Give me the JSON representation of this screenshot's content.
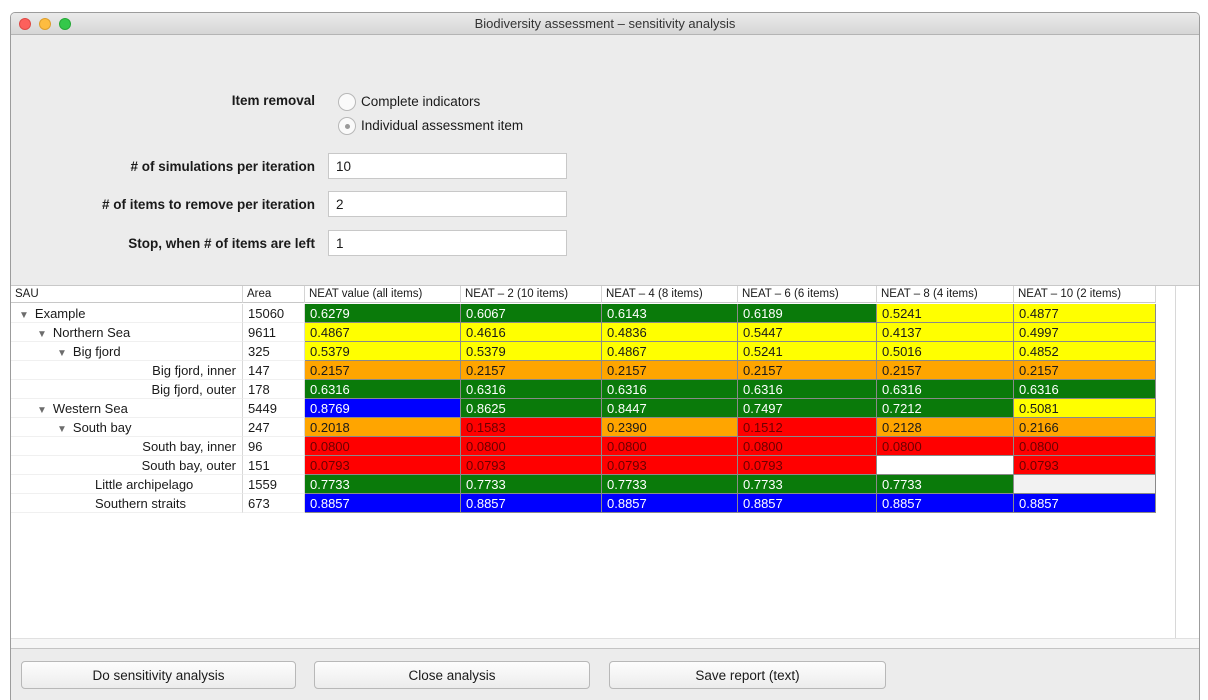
{
  "window": {
    "title": "Biodiversity assessment – sensitivity analysis"
  },
  "form": {
    "item_removal_label": "Item removal",
    "radio_options": [
      {
        "label": "Complete indicators",
        "selected": false
      },
      {
        "label": "Individual assessment item",
        "selected": true
      }
    ],
    "simulations_label": "# of simulations per iteration",
    "simulations_value": "10",
    "remove_label": "# of items to remove per iteration",
    "remove_value": "2",
    "stop_label": "Stop, when # of items are left",
    "stop_value": "1"
  },
  "table": {
    "headers": [
      "SAU",
      "Area",
      "NEAT value (all items)",
      "NEAT – 2 (10 items)",
      "NEAT – 4 (8 items)",
      "NEAT – 6 (6 items)",
      "NEAT – 8 (4 items)",
      "NEAT – 10 (2 items)"
    ],
    "rows": [
      {
        "sau": "Example",
        "area": "15060",
        "values": [
          "0.6279",
          "0.6067",
          "0.6143",
          "0.6189",
          "0.5241",
          "0.4877"
        ],
        "colors": [
          "green",
          "green",
          "green",
          "green",
          "yellow",
          "yellow"
        ]
      },
      {
        "sau": "Northern Sea",
        "area": "9611",
        "values": [
          "0.4867",
          "0.4616",
          "0.4836",
          "0.5447",
          "0.4137",
          "0.4997"
        ],
        "colors": [
          "yellow",
          "yellow",
          "yellow",
          "yellow",
          "yellow",
          "yellow"
        ]
      },
      {
        "sau": "Big fjord",
        "area": "325",
        "values": [
          "0.5379",
          "0.5379",
          "0.4867",
          "0.5241",
          "0.5016",
          "0.4852"
        ],
        "colors": [
          "yellow",
          "yellow",
          "yellow",
          "yellow",
          "yellow",
          "yellow"
        ]
      },
      {
        "sau": "Big fjord, inner",
        "area": "147",
        "values": [
          "0.2157",
          "0.2157",
          "0.2157",
          "0.2157",
          "0.2157",
          "0.2157"
        ],
        "colors": [
          "orange",
          "orange",
          "orange",
          "orange",
          "orange",
          "orange"
        ]
      },
      {
        "sau": "Big fjord, outer",
        "area": "178",
        "values": [
          "0.6316",
          "0.6316",
          "0.6316",
          "0.6316",
          "0.6316",
          "0.6316"
        ],
        "colors": [
          "green",
          "green",
          "green",
          "green",
          "green",
          "green"
        ]
      },
      {
        "sau": "Western Sea",
        "area": "5449",
        "values": [
          "0.8769",
          "0.8625",
          "0.8447",
          "0.7497",
          "0.7212",
          "0.5081"
        ],
        "colors": [
          "blue",
          "green",
          "green",
          "green",
          "green",
          "yellow"
        ]
      },
      {
        "sau": "South bay",
        "area": "247",
        "values": [
          "0.2018",
          "0.1583",
          "0.2390",
          "0.1512",
          "0.2128",
          "0.2166"
        ],
        "colors": [
          "orange",
          "red",
          "orange",
          "red",
          "orange",
          "orange"
        ]
      },
      {
        "sau": "South bay, inner",
        "area": "96",
        "values": [
          "0.0800",
          "0.0800",
          "0.0800",
          "0.0800",
          "0.0800",
          "0.0800"
        ],
        "colors": [
          "red",
          "red",
          "red",
          "red",
          "red",
          "red"
        ]
      },
      {
        "sau": "South bay, outer",
        "area": "151",
        "values": [
          "0.0793",
          "0.0793",
          "0.0793",
          "0.0793",
          "",
          "0.0793"
        ],
        "colors": [
          "red",
          "red",
          "red",
          "red",
          "white",
          "red"
        ]
      },
      {
        "sau": "Little archipelago",
        "area": "1559",
        "values": [
          "0.7733",
          "0.7733",
          "0.7733",
          "0.7733",
          "0.7733",
          ""
        ],
        "colors": [
          "green",
          "green",
          "green",
          "green",
          "green",
          "empty"
        ]
      },
      {
        "sau": "Southern straits",
        "area": "673",
        "values": [
          "0.8857",
          "0.8857",
          "0.8857",
          "0.8857",
          "0.8857",
          "0.8857"
        ],
        "colors": [
          "blue",
          "blue",
          "blue",
          "blue",
          "blue",
          "blue"
        ]
      }
    ]
  },
  "buttons": {
    "do_analysis": "Do sensitivity analysis",
    "close": "Close analysis",
    "save_report": "Save report (text)"
  },
  "colors": {
    "green": "#0a7a0a",
    "yellow": "#ffff00",
    "orange": "#ffa500",
    "red": "#ff0000",
    "blue": "#0000ff",
    "window_bg": "#ececec"
  }
}
